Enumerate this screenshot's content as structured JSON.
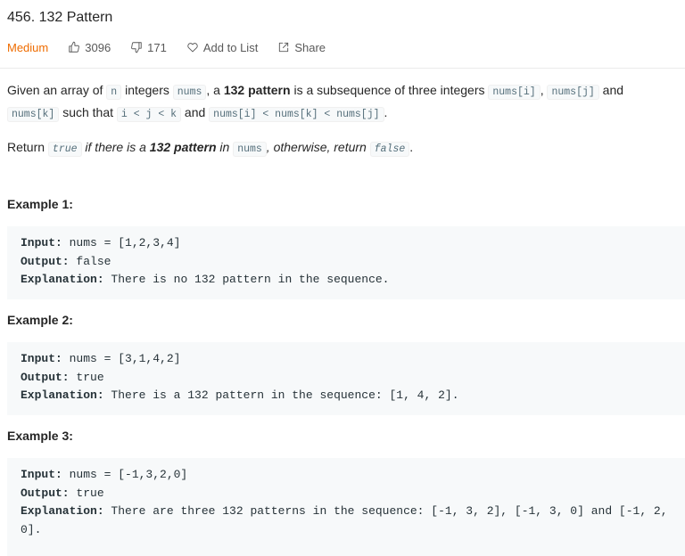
{
  "problem": {
    "title": "456. 132 Pattern",
    "difficulty": "Medium",
    "likes": "3096",
    "dislikes": "171",
    "add_to_list": "Add to List",
    "share": "Share"
  },
  "description": {
    "p1": {
      "t1": "Given an array of ",
      "c1": "n",
      "t2": " integers ",
      "c2": "nums",
      "t3": ", a ",
      "b1": "132 pattern",
      "t4": " is a subsequence of three integers ",
      "c3": "nums[i]",
      "t5": ", ",
      "c4": "nums[j]",
      "t6": " and ",
      "c5": "nums[k]",
      "t7": " such that ",
      "c6": "i < j < k",
      "t8": " and ",
      "c7": "nums[i] < nums[k] < nums[j]",
      "t9": "."
    },
    "p2": {
      "t1": "Return ",
      "c1": "true",
      "t2": " if there is a ",
      "b1": "132 pattern",
      "t3": " in ",
      "c2": "nums",
      "t4": ", otherwise, return ",
      "c3": "false",
      "t5": "."
    }
  },
  "examples": [
    {
      "title": "Example 1:",
      "input_label": "Input:",
      "input": " nums = [1,2,3,4]",
      "output_label": "Output:",
      "output": " false",
      "explanation_label": "Explanation:",
      "explanation": " There is no 132 pattern in the sequence."
    },
    {
      "title": "Example 2:",
      "input_label": "Input:",
      "input": " nums = [3,1,4,2]",
      "output_label": "Output:",
      "output": " true",
      "explanation_label": "Explanation:",
      "explanation": " There is a 132 pattern in the sequence: [1, 4, 2]."
    },
    {
      "title": "Example 3:",
      "input_label": "Input:",
      "input": " nums = [-1,3,2,0]",
      "output_label": "Output:",
      "output": " true",
      "explanation_label": "Explanation:",
      "explanation": " There are three 132 patterns in the sequence: [-1, 3, 2], [-1, 3, 0] and [-1, 2, 0]."
    }
  ],
  "colors": {
    "difficulty_medium": "#ef6c00",
    "code_bg": "#f7f9fa",
    "code_fg": "#546e7a"
  }
}
